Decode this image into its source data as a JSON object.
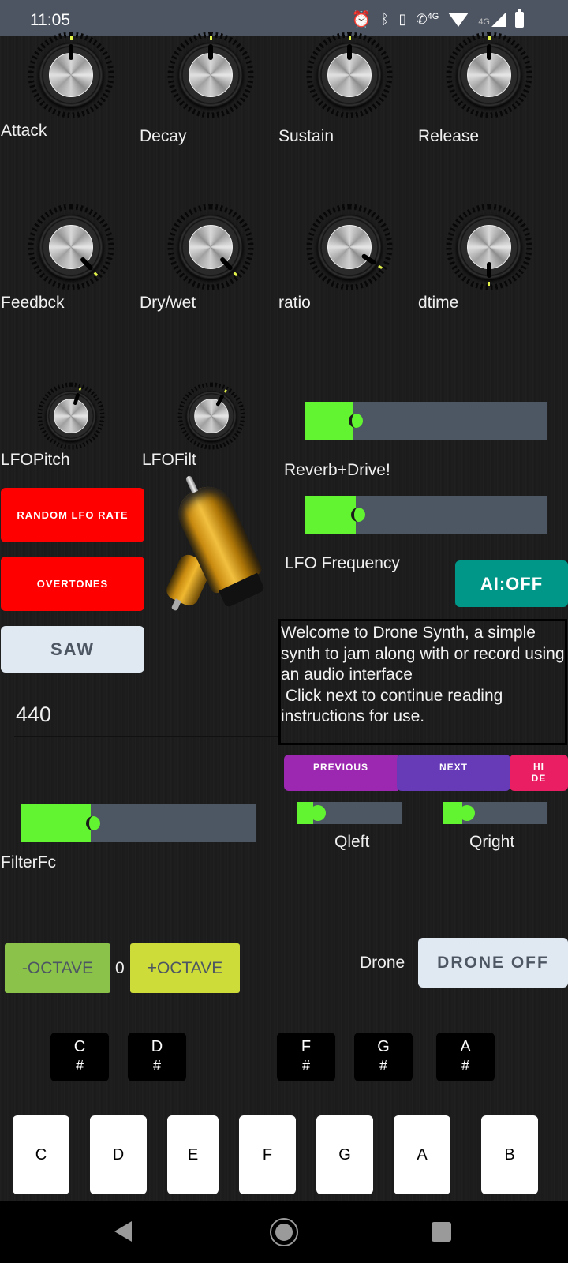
{
  "status_bar": {
    "time": "11:05",
    "icons": [
      "alarm-icon",
      "bluetooth-icon",
      "vibrate-icon",
      "volte-call-icon",
      "wifi-icon",
      "cellular-signal-icon",
      "battery-icon"
    ],
    "volte_label": "4G",
    "network_label": "4G"
  },
  "knobs": [
    {
      "id": "attack",
      "label": "Attack",
      "value": 0.5
    },
    {
      "id": "decay",
      "label": "Decay",
      "value": 0.5
    },
    {
      "id": "sustain",
      "label": "Sustain",
      "value": 0.5
    },
    {
      "id": "release",
      "label": "Release",
      "value": 0.5
    },
    {
      "id": "feedback",
      "label": "Feedbck",
      "value": 0.88
    },
    {
      "id": "drywet",
      "label": "Dry/wet",
      "value": 0.88
    },
    {
      "id": "ratio",
      "label": "ratio",
      "value": 0.84
    },
    {
      "id": "dtime",
      "label": "dtime",
      "value": 1.0
    },
    {
      "id": "lfopitch",
      "label": "LFOPitch",
      "value": 0.55
    },
    {
      "id": "lfofilt",
      "label": "LFOFilt",
      "value": 0.58
    }
  ],
  "sliders": {
    "reverb_drive": {
      "label": "Reverb+Drive!",
      "value": 0.2
    },
    "lfo_frequency": {
      "label": "LFO Frequency",
      "value": 0.21
    },
    "filter_fc": {
      "label": "FilterFc",
      "value": 0.3
    },
    "q_left": {
      "label": "Qleft",
      "value": 0.16
    },
    "q_right": {
      "label": "Qright",
      "value": 0.19
    }
  },
  "buttons": {
    "random_lfo_rate": "RANDOM LFO RATE",
    "overtones": "OVERTONES",
    "waveform": "SAW",
    "ai_toggle": "AI:OFF",
    "previous": "PREVIOUS",
    "next": "NEXT",
    "hide": "HI\nDE",
    "octave_down": "-OCTAVE",
    "octave_up": "+OCTAVE",
    "drone_toggle": "DRONE OFF"
  },
  "frequency_input": {
    "value": "440"
  },
  "info_text": "Welcome to Drone Synth, a simple synth to jam along with or record using an audio interface\n Click next to continue reading instructions for use.",
  "octave_value": "0",
  "drone_label": "Drone",
  "keyboard": {
    "black_keys": [
      {
        "note": "C",
        "accidental": "#"
      },
      {
        "note": "D",
        "accidental": "#"
      },
      {
        "note": "F",
        "accidental": "#"
      },
      {
        "note": "G",
        "accidental": "#"
      },
      {
        "note": "A",
        "accidental": "#"
      }
    ],
    "white_keys": [
      "C",
      "D",
      "E",
      "F",
      "G",
      "A",
      "B"
    ]
  },
  "colors": {
    "slider_fill": "#62f431",
    "slider_track": "#4d5663",
    "red_button": "#ff0000",
    "teal_button": "#009688",
    "purple_button": "#9c27b0",
    "violet_button": "#673ab7",
    "pink_button": "#e91e63",
    "green_button": "#8bc34a",
    "lime_button": "#cddc39"
  }
}
